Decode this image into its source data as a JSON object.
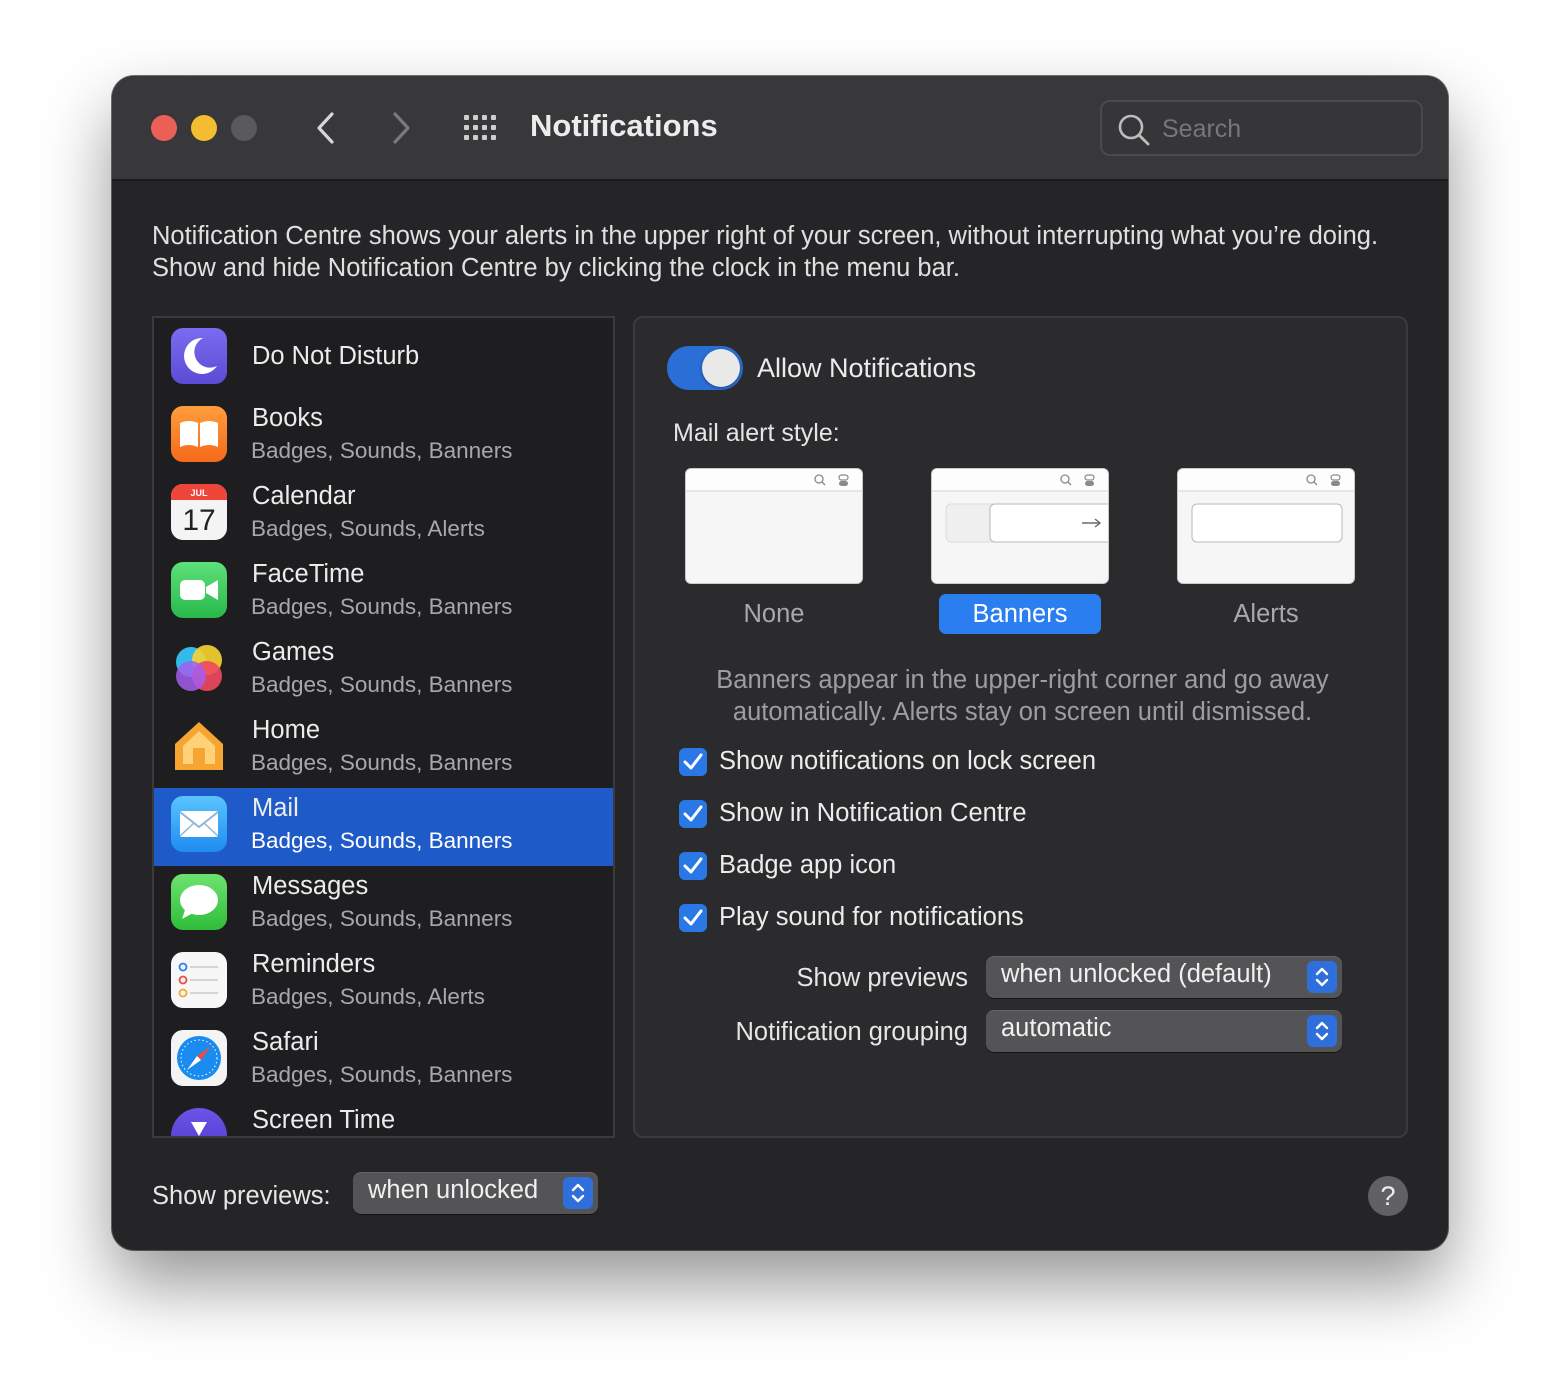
{
  "window": {
    "title": "Notifications",
    "search_placeholder": "Search"
  },
  "intro": "Notification Centre shows your alerts in the upper right of your screen, without interrupting what you’re doing. Show and hide Notification Centre by clicking the clock in the menu bar.",
  "apps": [
    {
      "name": "Do Not Disturb",
      "sub": "",
      "icon": "moon-icon"
    },
    {
      "name": "Books",
      "sub": "Badges, Sounds, Banners",
      "icon": "books-icon"
    },
    {
      "name": "Calendar",
      "sub": "Badges, Sounds, Alerts",
      "icon": "calendar-icon",
      "icon_month": "JUL",
      "icon_day": "17"
    },
    {
      "name": "FaceTime",
      "sub": "Badges, Sounds, Banners",
      "icon": "facetime-icon"
    },
    {
      "name": "Games",
      "sub": "Badges, Sounds, Banners",
      "icon": "games-icon"
    },
    {
      "name": "Home",
      "sub": "Badges, Sounds, Banners",
      "icon": "home-icon"
    },
    {
      "name": "Mail",
      "sub": "Badges, Sounds, Banners",
      "icon": "mail-icon",
      "selected": true
    },
    {
      "name": "Messages",
      "sub": "Badges, Sounds, Banners",
      "icon": "messages-icon"
    },
    {
      "name": "Reminders",
      "sub": "Badges, Sounds, Alerts",
      "icon": "reminders-icon"
    },
    {
      "name": "Safari",
      "sub": "Badges, Sounds, Banners",
      "icon": "safari-icon"
    },
    {
      "name": "Screen Time",
      "sub": "",
      "icon": "screen-time-icon"
    }
  ],
  "detail": {
    "allow_label": "Allow Notifications",
    "allow_enabled": true,
    "style_label": "Mail alert style:",
    "styles": [
      "None",
      "Banners",
      "Alerts"
    ],
    "selected_style": "Banners",
    "hint": "Banners appear in the upper-right corner and go away automatically. Alerts stay on screen until dismissed.",
    "checks": [
      {
        "label": "Show notifications on lock screen",
        "checked": true
      },
      {
        "label": "Show in Notification Centre",
        "checked": true
      },
      {
        "label": "Badge app icon",
        "checked": true
      },
      {
        "label": "Play sound for notifications",
        "checked": true
      }
    ],
    "show_previews_label": "Show previews",
    "show_previews_value": "when unlocked (default)",
    "grouping_label": "Notification grouping",
    "grouping_value": "automatic"
  },
  "footer": {
    "show_previews_label": "Show previews:",
    "show_previews_value": "when unlocked",
    "help": "?"
  },
  "colors": {
    "accent": "#2a7ef0",
    "selection": "#1f5ac9",
    "close": "#ec5f57",
    "minimize": "#f4bd2f"
  }
}
